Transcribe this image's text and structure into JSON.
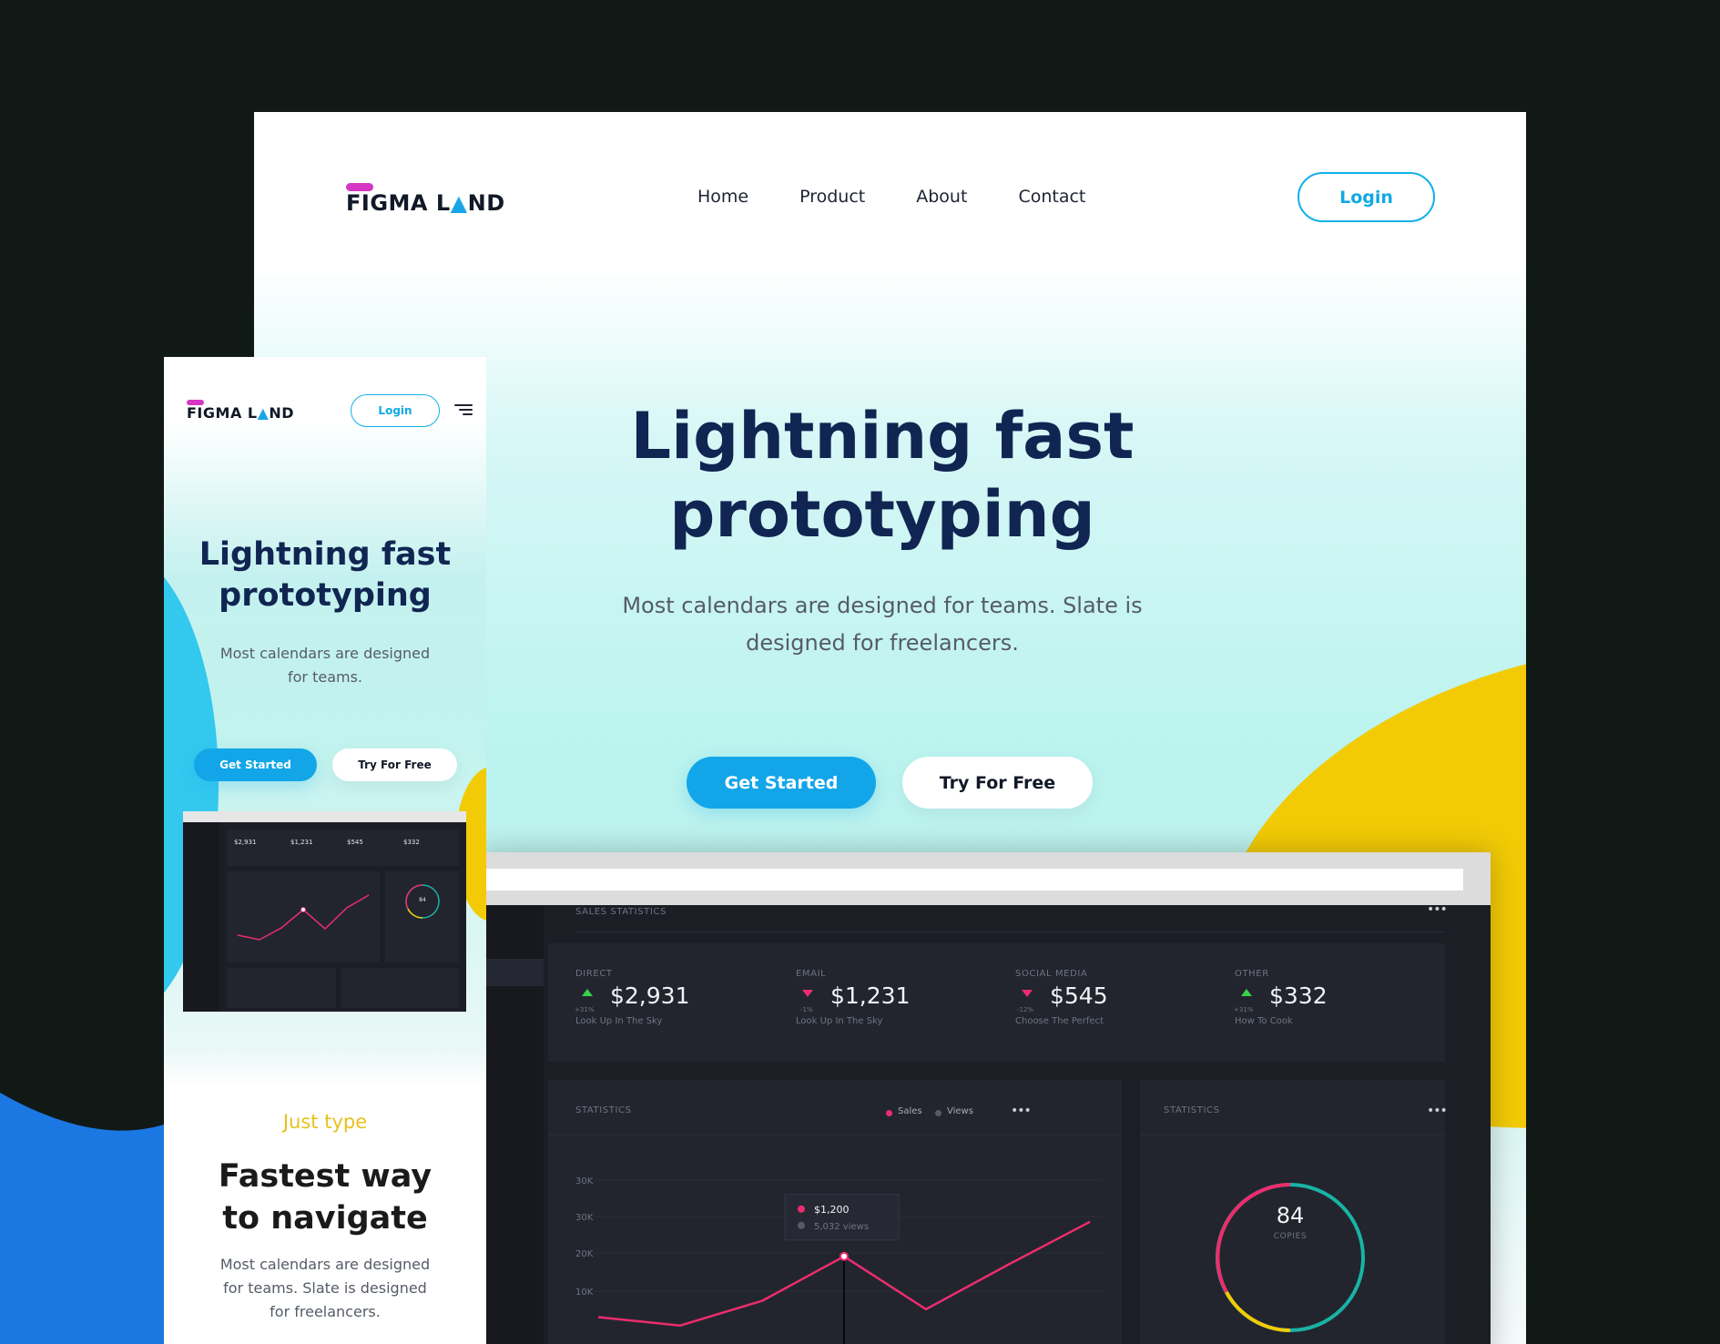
{
  "brand": {
    "name": "FIGMA LAND",
    "accent": "#12a6e8",
    "title_color": "#112552",
    "highlight": "#f2cb06",
    "logo_bar": "#d636c4"
  },
  "desktop": {
    "nav": [
      "Home",
      "Product",
      "About",
      "Contact"
    ],
    "login_label": "Login",
    "hero": {
      "title_line1": "Lightning fast",
      "title_line2": "prototyping",
      "subtitle_line1": "Most calendars are designed for teams. Slate is",
      "subtitle_line2": "designed for freelancers.",
      "get_started": "Get Started",
      "try_free": "Try For Free"
    },
    "dashboard": {
      "section_title": "SALES STATISTICS",
      "channels": [
        {
          "label": "DIRECT",
          "value": "$2,931",
          "change": "+31%",
          "trend": "up",
          "caption": "Look Up In The Sky"
        },
        {
          "label": "EMAIL",
          "value": "$1,231",
          "change": "-1%",
          "trend": "down",
          "caption": "Look Up In The Sky"
        },
        {
          "label": "SOCIAL MEDIA",
          "value": "$545",
          "change": "-12%",
          "trend": "down",
          "caption": "Choose The Perfect"
        },
        {
          "label": "OTHER",
          "value": "$332",
          "change": "+31%",
          "trend": "up",
          "caption": "How To Cook"
        }
      ],
      "stats_title": "STATISTICS",
      "legend": [
        "Sales",
        "Views"
      ],
      "tooltip": {
        "value": "$1,200",
        "views": "5,032 views"
      },
      "donut": {
        "value": "84",
        "label": "COPIES",
        "title": "STATISTICS"
      },
      "chart_data": {
        "type": "line",
        "y_tick_labels": [
          "30K",
          "30K",
          "20K",
          "10K"
        ],
        "series": [
          {
            "name": "Sales",
            "color": "#ec2d6d",
            "values": [
              8.2,
              6.5,
              11.5,
              20.5,
              9.8,
              18.8,
              27.5
            ]
          }
        ],
        "ylim": [
          0,
          40
        ],
        "highlight_index": 3
      }
    }
  },
  "mobile": {
    "login_label": "Login",
    "hero": {
      "title_line1": "Lightning fast",
      "title_line2": "prototyping",
      "subtitle_line1": "Most calendars are designed",
      "subtitle_line2": "for teams.",
      "get_started": "Get Started",
      "try_free": "Try For Free"
    },
    "mini_dash_values": [
      "$2,931",
      "$1,231",
      "$545",
      "$332"
    ],
    "mini_donut_value": "84",
    "section": {
      "eyebrow": "Just type",
      "title_line1": "Fastest way",
      "title_line2": "to navigate",
      "body_line1": "Most calendars are designed",
      "body_line2": "for teams. Slate is designed",
      "body_line3": "for freelancers."
    }
  }
}
